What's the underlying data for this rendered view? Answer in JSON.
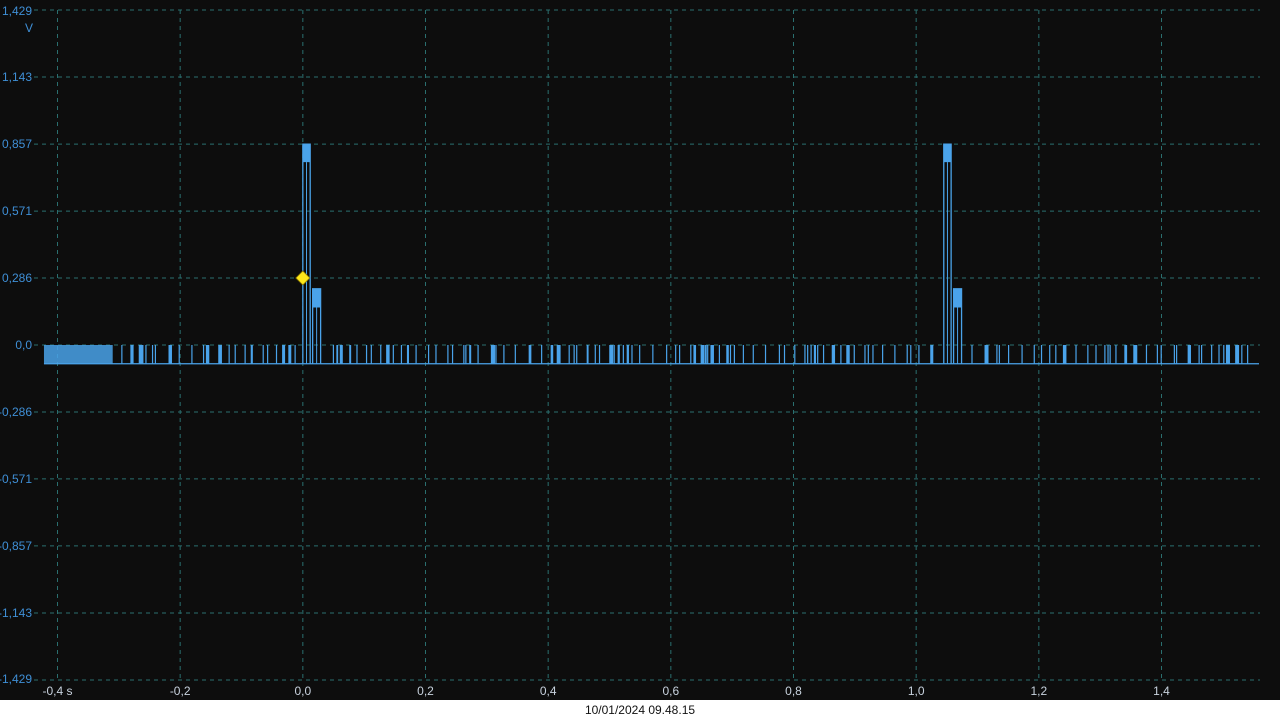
{
  "timestamp": "10/01/2024 09.48.15",
  "colors": {
    "background": "#0d0d0d",
    "grid": "#2a6f6f",
    "axis_text": "#3f8fd6",
    "trace": "#4aa3ea",
    "trigger_marker": "#ffe81a",
    "footer_bg": "#ffffff",
    "footer_text": "#111111"
  },
  "chart_data": {
    "type": "line",
    "title": "",
    "xlabel": "",
    "ylabel": "",
    "y_unit": "V",
    "x_unit": "s",
    "xlim": [
      -0.44,
      1.56
    ],
    "ylim": [
      -1.429,
      1.429
    ],
    "grid": true,
    "x_ticks": [
      {
        "value": -0.4,
        "label": "-0,4 s"
      },
      {
        "value": -0.2,
        "label": "-0,2"
      },
      {
        "value": 0.0,
        "label": "0,0"
      },
      {
        "value": 0.2,
        "label": "0,2"
      },
      {
        "value": 0.4,
        "label": "0,4"
      },
      {
        "value": 0.6,
        "label": "0,6"
      },
      {
        "value": 0.8,
        "label": "0,8"
      },
      {
        "value": 1.0,
        "label": "1,0"
      },
      {
        "value": 1.2,
        "label": "1,2"
      },
      {
        "value": 1.4,
        "label": "1,4"
      }
    ],
    "y_ticks": [
      {
        "value": 1.429,
        "label": "1,429"
      },
      {
        "value": 1.143,
        "label": "1,143"
      },
      {
        "value": 0.857,
        "label": "0,857"
      },
      {
        "value": 0.571,
        "label": "0,571"
      },
      {
        "value": 0.286,
        "label": "0,286"
      },
      {
        "value": 0.0,
        "label": "0,0"
      },
      {
        "value": -0.286,
        "label": "-0,286"
      },
      {
        "value": -0.571,
        "label": "-0,571"
      },
      {
        "value": -0.857,
        "label": "-0,857"
      },
      {
        "value": -1.143,
        "label": "-1,143"
      },
      {
        "value": -1.429,
        "label": "-1,429"
      }
    ],
    "series": [
      {
        "baseline": -0.08,
        "noise_high": 0.0,
        "noise_range": [
          -0.44,
          1.56
        ],
        "dense_noise_range": [
          -0.44,
          -0.31
        ],
        "pulses": [
          {
            "start": 0.0,
            "end": 0.012,
            "level": 0.857,
            "inner_level": 0.78
          },
          {
            "start": 0.016,
            "end": 0.029,
            "level": 0.24,
            "inner_level": 0.16
          },
          {
            "start": 1.045,
            "end": 1.057,
            "level": 0.857,
            "inner_level": 0.78
          },
          {
            "start": 1.061,
            "end": 1.074,
            "level": 0.24,
            "inner_level": 0.16
          }
        ]
      }
    ],
    "trigger": {
      "x": 0.0,
      "y": 0.286
    }
  }
}
